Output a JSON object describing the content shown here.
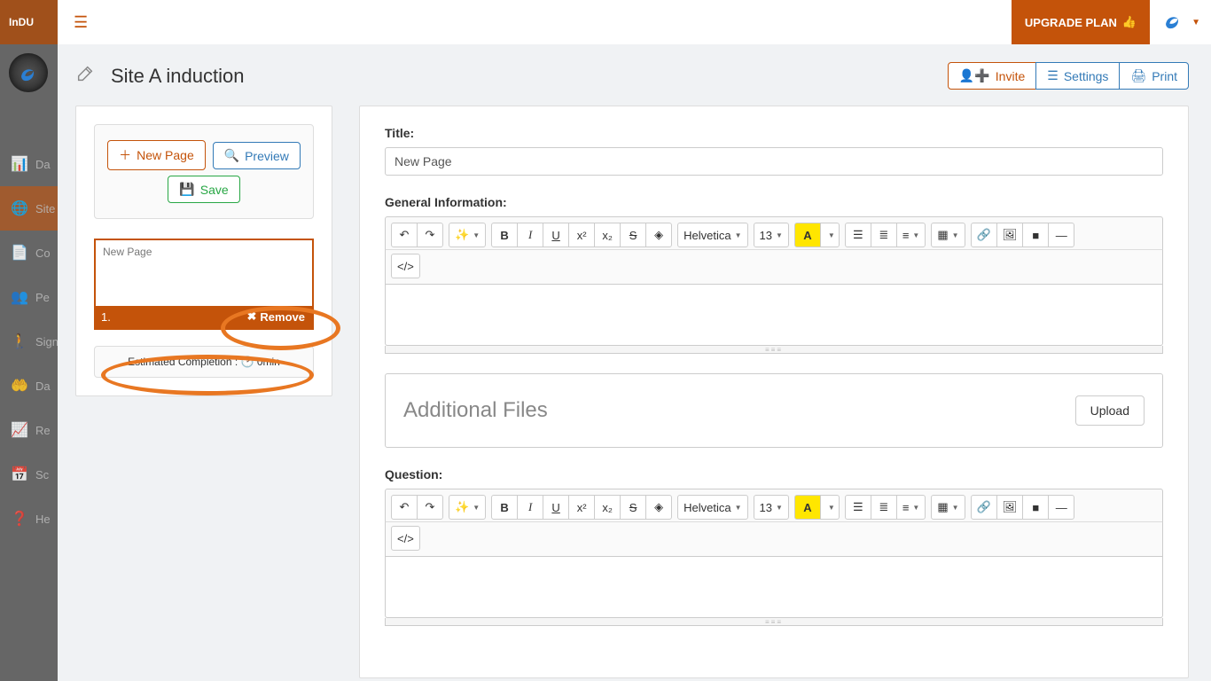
{
  "brand_partial": "InDU",
  "sidebar": {
    "items": [
      {
        "label": "Da",
        "icon": "📊"
      },
      {
        "label": "Site",
        "icon": "🌐",
        "active": true
      },
      {
        "label": "Co",
        "icon": "📄"
      },
      {
        "label": "Pe",
        "icon": "👥"
      },
      {
        "label": "Sign",
        "icon": "🚶"
      },
      {
        "label": "Da",
        "icon": "🤲"
      },
      {
        "label": "Re",
        "icon": "📈"
      },
      {
        "label": "Sc",
        "icon": "📅"
      },
      {
        "label": "He",
        "icon": "❓"
      }
    ]
  },
  "topbar": {
    "upgrade_label": "UPGRADE PLAN"
  },
  "page": {
    "title": "Site A induction",
    "actions": {
      "invite": "Invite",
      "settings": "Settings",
      "print": "Print"
    }
  },
  "page_list": {
    "new_page_btn": "New Page",
    "preview_btn": "Preview",
    "save_btn": "Save",
    "card": {
      "title": "New Page",
      "index": "1.",
      "remove": "Remove"
    },
    "est_label": "Estimated Completion :",
    "est_value": "0min"
  },
  "editor": {
    "title_label": "Title:",
    "title_value": "New Page",
    "general_label": "General Information:",
    "files_heading": "Additional Files",
    "upload_btn": "Upload",
    "question_label": "Question:",
    "font_family": "Helvetica",
    "font_size": "13"
  }
}
